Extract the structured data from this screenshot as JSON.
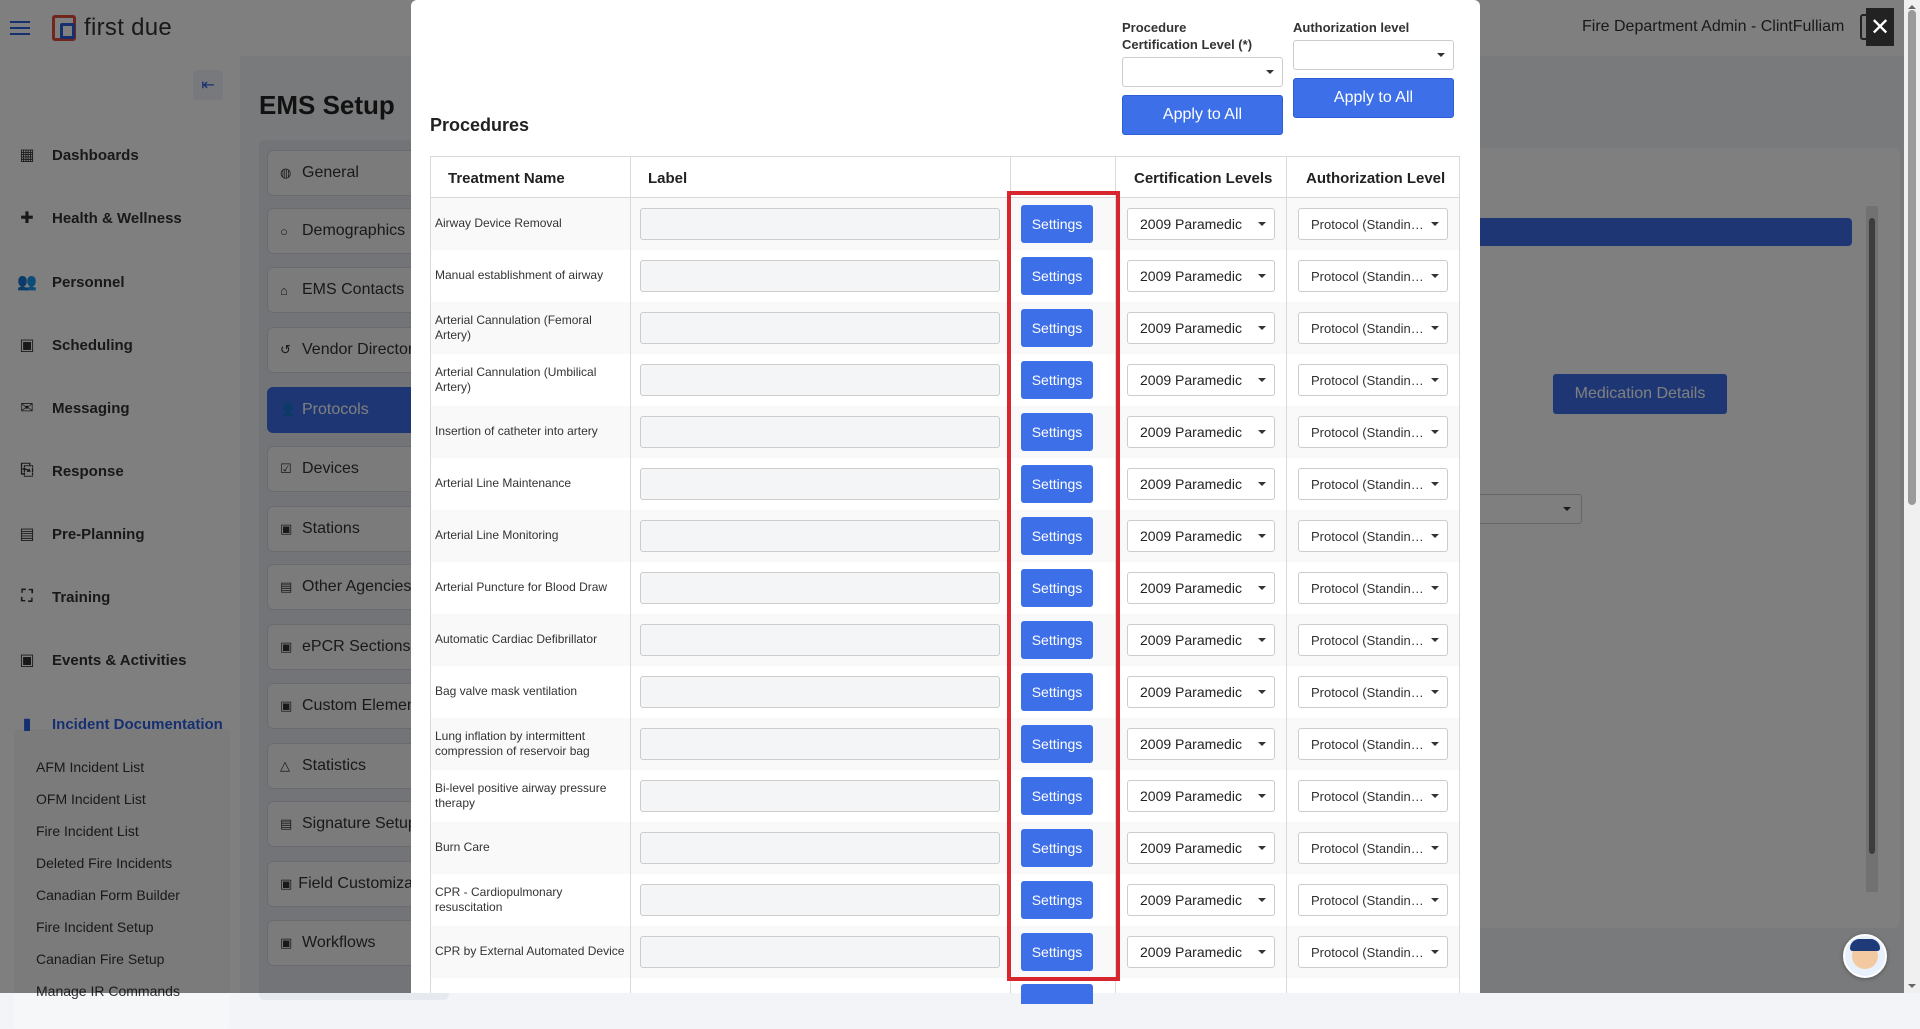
{
  "header": {
    "logo_text": "first due",
    "user_label": "Fire Department Admin - ClintFulliam"
  },
  "sidebar": {
    "items": [
      {
        "label": "Dashboards",
        "icon": "dashboard-icon",
        "glyph": "▦"
      },
      {
        "label": "Health & Wellness",
        "icon": "plus-icon",
        "glyph": "✚"
      },
      {
        "label": "Personnel",
        "icon": "people-icon",
        "glyph": "👥"
      },
      {
        "label": "Scheduling",
        "icon": "calendar-icon",
        "glyph": "▣"
      },
      {
        "label": "Messaging",
        "icon": "envelope-icon",
        "glyph": "✉"
      },
      {
        "label": "Response",
        "icon": "response-icon",
        "glyph": "⎘"
      },
      {
        "label": "Pre-Planning",
        "icon": "map-icon",
        "glyph": "▤"
      },
      {
        "label": "Training",
        "icon": "training-icon",
        "glyph": "⛶"
      },
      {
        "label": "Events & Activities",
        "icon": "event-calendar-icon",
        "glyph": "▣"
      },
      {
        "label": "Incident Documentation",
        "icon": "document-icon",
        "glyph": "▮"
      }
    ],
    "subitems": [
      "AFM Incident List",
      "OFM Incident List",
      "Fire Incident List",
      "Deleted Fire Incidents",
      "Canadian Form Builder",
      "Fire Incident Setup",
      "Canadian Fire Setup",
      "Manage IR Commands"
    ]
  },
  "main": {
    "page_title": "EMS Setup",
    "tabs": [
      {
        "label": "General",
        "glyph": "◍"
      },
      {
        "label": "Demographics",
        "glyph": "○"
      },
      {
        "label": "EMS Contacts",
        "glyph": "⌂"
      },
      {
        "label": "Vendor Directory",
        "glyph": "↺"
      },
      {
        "label": "Protocols",
        "glyph": "👤"
      },
      {
        "label": "Devices",
        "glyph": "☑"
      },
      {
        "label": "Stations",
        "glyph": "▣"
      },
      {
        "label": "Other Agencies A",
        "glyph": "▤"
      },
      {
        "label": "ePCR Sections",
        "glyph": "▣"
      },
      {
        "label": "Custom Elements",
        "glyph": "▣"
      },
      {
        "label": "Statistics",
        "glyph": "△"
      },
      {
        "label": "Signature Setup",
        "glyph": "▤"
      },
      {
        "label": "Field Customization",
        "glyph": "▣"
      },
      {
        "label": "Workflows",
        "glyph": "▣"
      }
    ],
    "medication_details_label": "Medication Details"
  },
  "modal": {
    "close_glyph": "✕",
    "title": "Procedures",
    "bulk": {
      "cert_label": "Procedure Certification Level (*)",
      "auth_label": "Authorization level",
      "apply_label": "Apply to All"
    },
    "columns": {
      "treatment": "Treatment Name",
      "label": "Label",
      "settings": "",
      "cert": "Certification Levels",
      "auth": "Authorization Level"
    },
    "rows": [
      {
        "name": "Airway Device Removal",
        "settings": "Settings",
        "cert": "2009 Paramedic",
        "auth": "Protocol (Standing Order)"
      },
      {
        "name": "Manual establishment of airway",
        "settings": "Settings",
        "cert": "2009 Paramedic",
        "auth": "Protocol (Standing Order)"
      },
      {
        "name": "Arterial Cannulation (Femoral Artery)",
        "settings": "Settings",
        "cert": "2009 Paramedic",
        "auth": "Protocol (Standing Order)"
      },
      {
        "name": "Arterial Cannulation (Umbilical Artery)",
        "settings": "Settings",
        "cert": "2009 Paramedic",
        "auth": "Protocol (Standing Order)"
      },
      {
        "name": "Insertion of catheter into artery",
        "settings": "Settings",
        "cert": "2009 Paramedic",
        "auth": "Protocol (Standing Order)"
      },
      {
        "name": "Arterial Line Maintenance",
        "settings": "Settings",
        "cert": "2009 Paramedic",
        "auth": "Protocol (Standing Order)"
      },
      {
        "name": "Arterial Line Monitoring",
        "settings": "Settings",
        "cert": "2009 Paramedic",
        "auth": "Protocol (Standing Order)"
      },
      {
        "name": "Arterial Puncture for Blood Draw",
        "settings": "Settings",
        "cert": "2009 Paramedic",
        "auth": "Protocol (Standing Order)"
      },
      {
        "name": "Automatic Cardiac Defibrillator",
        "settings": "Settings",
        "cert": "2009 Paramedic",
        "auth": "Protocol (Standing Order)"
      },
      {
        "name": "Bag valve mask ventilation",
        "settings": "Settings",
        "cert": "2009 Paramedic",
        "auth": "Protocol (Standing Order)"
      },
      {
        "name": "Lung inflation by intermittent compression of reservoir bag",
        "settings": "Settings",
        "cert": "2009 Paramedic",
        "auth": "Protocol (Standing Order)"
      },
      {
        "name": "Bi-level positive airway pressure therapy",
        "settings": "Settings",
        "cert": "2009 Paramedic",
        "auth": "Protocol (Standing Order)"
      },
      {
        "name": "Burn Care",
        "settings": "Settings",
        "cert": "2009 Paramedic",
        "auth": "Protocol (Standing Order)"
      },
      {
        "name": "CPR - Cardiopulmonary resuscitation",
        "settings": "Settings",
        "cert": "2009 Paramedic",
        "auth": "Protocol (Standing Order)"
      },
      {
        "name": "CPR by External Automated Device",
        "settings": "Settings",
        "cert": "2009 Paramedic",
        "auth": "Protocol (Standing Order)"
      }
    ]
  },
  "colors": {
    "primary": "#3c6fe8",
    "highlight": "#d7262e",
    "brand_red": "#e04a3a",
    "brand_blue": "#2b5fe0"
  }
}
